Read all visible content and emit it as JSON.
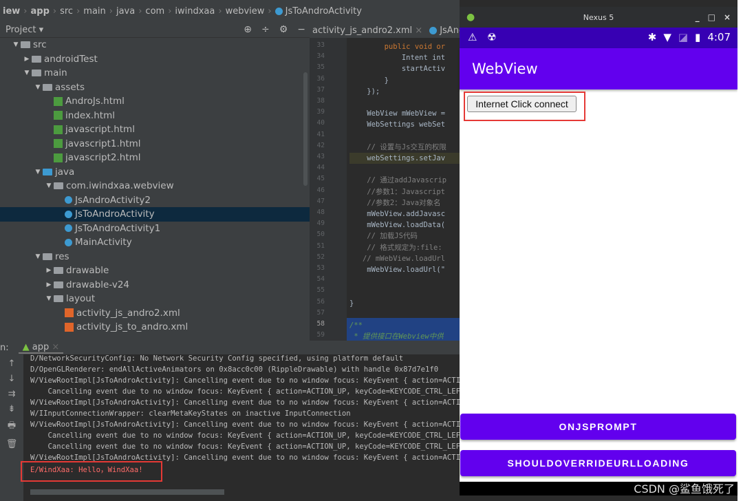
{
  "breadcrumb": [
    "iew",
    "app",
    "src",
    "main",
    "java",
    "com",
    "iwindxaa",
    "webview",
    "JsToAndroActivity"
  ],
  "project_header": {
    "label": "Project ▾",
    "tools": [
      "⊕",
      "÷",
      "⚙",
      "−"
    ]
  },
  "editor_tabs": [
    {
      "label": "activity_js_andro2.xml",
      "close": "×"
    },
    {
      "label": "JsAnd"
    }
  ],
  "tree": [
    {
      "d": 0,
      "a": "▼",
      "icon": "folder",
      "label": "src"
    },
    {
      "d": 1,
      "a": "▶",
      "icon": "folder",
      "label": "androidTest"
    },
    {
      "d": 1,
      "a": "▼",
      "icon": "folder",
      "label": "main"
    },
    {
      "d": 2,
      "a": "▼",
      "icon": "folder",
      "label": "assets"
    },
    {
      "d": 3,
      "a": "",
      "icon": "html",
      "label": "AndroJs.html"
    },
    {
      "d": 3,
      "a": "",
      "icon": "html",
      "label": "index.html"
    },
    {
      "d": 3,
      "a": "",
      "icon": "html",
      "label": "javascript.html"
    },
    {
      "d": 3,
      "a": "",
      "icon": "html",
      "label": "javascript1.html"
    },
    {
      "d": 3,
      "a": "",
      "icon": "html",
      "label": "javascript2.html"
    },
    {
      "d": 2,
      "a": "▼",
      "icon": "folder-blue",
      "label": "java"
    },
    {
      "d": 3,
      "a": "▼",
      "icon": "folder",
      "label": "com.iwindxaa.webview"
    },
    {
      "d": 4,
      "a": "",
      "icon": "class",
      "label": "JsAndroActivity2"
    },
    {
      "d": 4,
      "a": "",
      "icon": "class",
      "label": "JsToAndroActivity",
      "selected": true
    },
    {
      "d": 4,
      "a": "",
      "icon": "class",
      "label": "JsToAndroActivity1"
    },
    {
      "d": 4,
      "a": "",
      "icon": "class",
      "label": "MainActivity"
    },
    {
      "d": 2,
      "a": "▼",
      "icon": "folder",
      "label": "res"
    },
    {
      "d": 3,
      "a": "▶",
      "icon": "folder",
      "label": "drawable"
    },
    {
      "d": 3,
      "a": "▶",
      "icon": "folder",
      "label": "drawable-v24"
    },
    {
      "d": 3,
      "a": "▼",
      "icon": "folder",
      "label": "layout"
    },
    {
      "d": 4,
      "a": "",
      "icon": "xml",
      "label": "activity_js_andro2.xml"
    },
    {
      "d": 4,
      "a": "",
      "icon": "xml",
      "label": "activity_js_to_andro.xml"
    }
  ],
  "code": [
    {
      "n": "33",
      "t": "        public void or",
      "c": "kw"
    },
    {
      "n": "34",
      "t": "            Intent int",
      "c": ""
    },
    {
      "n": "35",
      "t": "            startActiv",
      "c": ""
    },
    {
      "n": "36",
      "t": "        }",
      "c": ""
    },
    {
      "n": "37",
      "t": "    });",
      "c": ""
    },
    {
      "n": "38",
      "t": "",
      "c": ""
    },
    {
      "n": "39",
      "t": "    WebView mWebView =",
      "c": ""
    },
    {
      "n": "40",
      "t": "    WebSettings webSet",
      "c": ""
    },
    {
      "n": "41",
      "t": "",
      "c": ""
    },
    {
      "n": "42",
      "t": "    // 设置与Js交互的权限",
      "c": "cm"
    },
    {
      "n": "43",
      "t": "    webSettings.setJav",
      "c": "hl"
    },
    {
      "n": "44",
      "t": "",
      "c": ""
    },
    {
      "n": "45",
      "t": "    // 通过addJavascrip",
      "c": "cm"
    },
    {
      "n": "46",
      "t": "    //参数1：Javascript",
      "c": "cm"
    },
    {
      "n": "47",
      "t": "    //参数2：Java对象名",
      "c": "cm"
    },
    {
      "n": "48",
      "t": "    mWebView.addJavasc",
      "c": ""
    },
    {
      "n": "49",
      "t": "    mWebView.loadData(",
      "c": ""
    },
    {
      "n": "50",
      "t": "    // 加载JS代码",
      "c": "cm"
    },
    {
      "n": "51",
      "t": "    // 格式规定为:file:",
      "c": "cm"
    },
    {
      "n": "52",
      "t": "   // mWebView.loadUrl",
      "c": "cm"
    },
    {
      "n": "53",
      "t": "    mWebView.loadUrl(\"",
      "c": ""
    },
    {
      "n": "54",
      "t": "",
      "c": ""
    },
    {
      "n": "55",
      "t": "",
      "c": ""
    },
    {
      "n": "56",
      "t": "}",
      "c": ""
    },
    {
      "n": "57",
      "t": "",
      "c": ""
    },
    {
      "n": "58",
      "t": "/**",
      "c": "doc"
    },
    {
      "n": "59",
      "t": " * 提供接口在Webview中供",
      "c": "doc"
    }
  ],
  "run": {
    "prefix": "n:",
    "tab": "app",
    "tools": [
      "↑",
      "↓",
      "⇉",
      "⇟",
      "🖶",
      "🗑"
    ],
    "logs": [
      {
        "t": "D/NetworkSecurityConfig: No Network Security Config specified, using platform default"
      },
      {
        "t": "D/OpenGLRenderer: endAllActiveAnimators on 0x8acc0c00 (RippleDrawable) with handle 0x87d7e1f0"
      },
      {
        "t": "W/ViewRootImpl[JsToAndroActivity]: Cancelling event due to no window focus: KeyEvent { action=ACTION"
      },
      {
        "t": "    Cancelling event due to no window focus: KeyEvent { action=ACTION_UP, keyCode=KEYCODE_CTRL_LEFT"
      },
      {
        "t": "W/ViewRootImpl[JsToAndroActivity]: Cancelling event due to no window focus: KeyEvent { action=ACTION"
      },
      {
        "t": "W/IInputConnectionWrapper: clearMetaKeyStates on inactive InputConnection"
      },
      {
        "t": "W/ViewRootImpl[JsToAndroActivity]: Cancelling event due to no window focus: KeyEvent { action=ACTION"
      },
      {
        "t": "    Cancelling event due to no window focus: KeyEvent { action=ACTION_UP, keyCode=KEYCODE_CTRL_LEFT"
      },
      {
        "t": "    Cancelling event due to no window focus: KeyEvent { action=ACTION_UP, keyCode=KEYCODE_CTRL_LEFT"
      },
      {
        "t": "W/ViewRootImpl[JsToAndroActivity]: Cancelling event due to no window focus: KeyEvent { action=ACTION"
      },
      {
        "t": "E/WindXaa: Hello，WindXaa!",
        "err": true
      }
    ]
  },
  "emulator": {
    "title": "Nexus 5",
    "window_controls": [
      "_",
      "□",
      "×"
    ],
    "status_time": "4:07",
    "status_icons": [
      "⚠",
      "✱",
      "▼",
      "◪",
      "▮"
    ],
    "app_title": "WebView",
    "web_button": "Internet Click connect",
    "buttons": [
      "ONJSPROMPT",
      "SHOULDOVERRIDEURLLOADING"
    ]
  },
  "watermark": "CSDN @鲨鱼饿死了",
  "colors": {
    "primary": "#6200ee",
    "primary_dark": "#3700b3",
    "highlight": "#e53935"
  }
}
